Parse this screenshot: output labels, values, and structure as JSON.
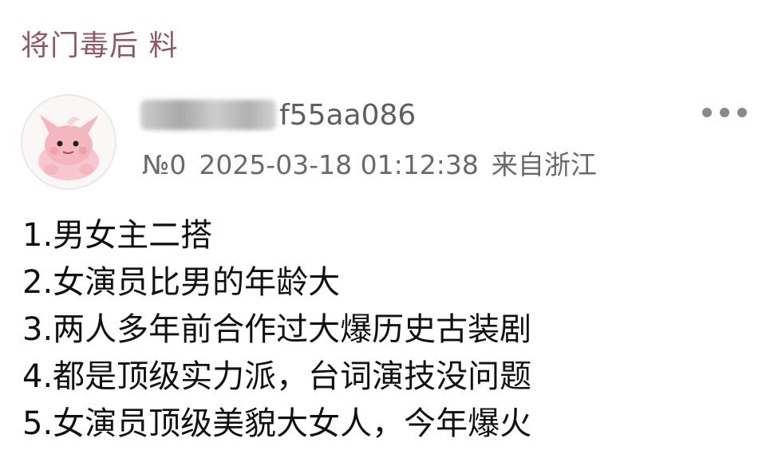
{
  "header": {
    "title": "将门毒后 料"
  },
  "post": {
    "username_suffix": "f55aa086",
    "post_number": "№0",
    "timestamp": "2025-03-18 01:12:38",
    "location": "来自浙江",
    "more_icon": "more-horizontal-icon",
    "avatar_icon": "pink-cartoon-avatar-icon"
  },
  "content": {
    "items": [
      "1.男女主二搭",
      "2.女演员比男的年龄大",
      "3.两人多年前合作过大爆历史古装剧",
      "4.都是顶级实力派，台词演技没问题",
      "5.女演员顶级美貌大女人，今年爆火"
    ]
  },
  "colors": {
    "title": "#8f5866",
    "text": "#111111",
    "meta": "#6a6a6a",
    "avatar_pink": "#f3b8bf"
  }
}
